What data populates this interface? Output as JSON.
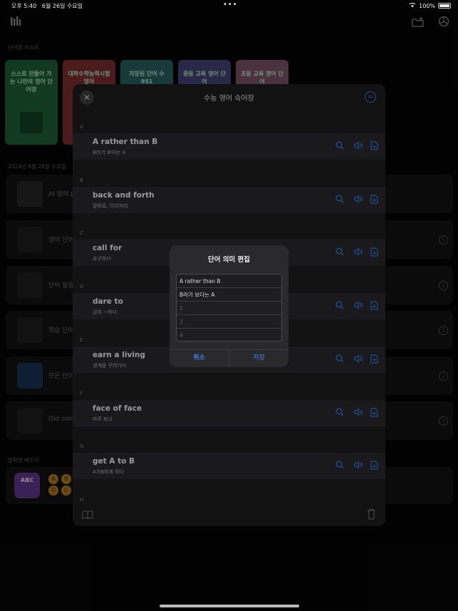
{
  "status_bar": {
    "time": "오후 5:40",
    "date": "6월 26일 수요일",
    "battery": "100%"
  },
  "background": {
    "wordbook_list_label": "단어장 리스트",
    "cards": [
      {
        "label": "스스로 만들어 가는 나만의 영어 단어장",
        "color": "#1f6b3c"
      },
      {
        "label": "대학수학능력시험 영어",
        "color": "#8a3434"
      },
      {
        "label": "저장된 단어 수 951",
        "color": "#2f6b6b"
      },
      {
        "label": "중등 교육 영어 단어",
        "color": "#4d4a86"
      },
      {
        "label": "초등 교육 영어 단어",
        "color": "#8b5a73"
      }
    ],
    "date_label": "2024년 6월 26일 수요일",
    "rows": [
      {
        "label": "AI 영어 D"
      },
      {
        "label": "영어 단어"
      },
      {
        "label": "단어 발음"
      },
      {
        "label": "학습 단어"
      },
      {
        "label": "모든 단어"
      },
      {
        "label": "Old solo"
      }
    ],
    "alphabet_label": "알파벳 배우기",
    "abc_label": "ABC",
    "letter_circles": [
      "A",
      "B",
      "D",
      "C"
    ]
  },
  "sheet": {
    "title": "수능 영어 숙어장",
    "sections": [
      {
        "letter": "A",
        "word": "A rather than B",
        "meaning": "B라기 보다는 A"
      },
      {
        "letter": "B",
        "word": "back and forth",
        "meaning": "앞뒤로, 이리저리"
      },
      {
        "letter": "C",
        "word": "call for",
        "meaning": "요구하다"
      },
      {
        "letter": "D",
        "word": "dare to",
        "meaning": "감히 ~하다"
      },
      {
        "letter": "E",
        "word": "earn a living",
        "meaning": "생계를 꾸려가다"
      },
      {
        "letter": "F",
        "word": "face of face",
        "meaning": "마주 보고"
      },
      {
        "letter": "G",
        "word": "get A to B",
        "meaning": "A가B하게 하다"
      }
    ],
    "last_letter": "H"
  },
  "dialog": {
    "title": "단어 의미 편집",
    "fields": [
      {
        "value": "A rather than B",
        "placeholder": ""
      },
      {
        "value": "B라기 보다는 A",
        "placeholder": ""
      },
      {
        "value": "",
        "placeholder": "2"
      },
      {
        "value": "",
        "placeholder": "3"
      },
      {
        "value": "",
        "placeholder": "4"
      }
    ],
    "cancel": "취소",
    "save": "저장"
  },
  "colors": {
    "accent": "#2f6fd6"
  }
}
